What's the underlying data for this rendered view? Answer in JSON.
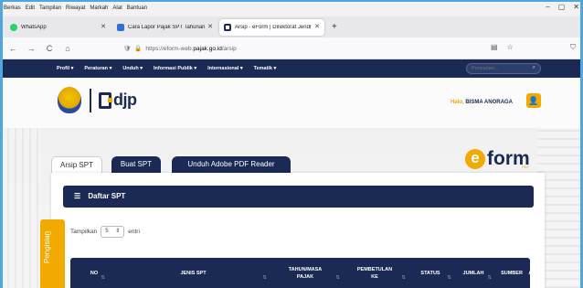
{
  "browser": {
    "menu": [
      "Berkas",
      "Edit",
      "Tampilan",
      "Riwayat",
      "Markah",
      "Alat",
      "Bantuan"
    ],
    "window_controls": {
      "minimize": "–",
      "maximize": "▢",
      "close": "✕"
    },
    "tabs": [
      {
        "title": "WhatsApp",
        "favicon_color": "#25d366",
        "active": false
      },
      {
        "title": "Cara Lapor Pajak SPT Tahunan",
        "favicon_color": "#2f6fd6",
        "active": false
      },
      {
        "title": "Arsip - eForm | Direktorat Jendr",
        "favicon_color": "#1a2a55",
        "active": true
      }
    ],
    "new_tab": "+",
    "nav": {
      "back": "←",
      "forward": "→",
      "reload": "C",
      "home": "⌂"
    },
    "url_prefix": "https://eform-web.",
    "url_host": "pajak.go.id",
    "url_path": "/arsip",
    "icons": [
      "reader-icon",
      "bookmark-star-icon",
      "shield-icon"
    ]
  },
  "site_nav": {
    "items": [
      "Profil ▾",
      "Peraturan ▾",
      "Unduh ▾",
      "Informasi Publik ▾",
      "Internasional ▾",
      "Tematik ▾"
    ],
    "search_placeholder": "Pencarian..."
  },
  "header": {
    "logo_text": "djp",
    "greeting": "Halo,",
    "user_name": "BISMA ANORAGA"
  },
  "eform_logo": {
    "e": "e",
    "form": "form",
    "tag": "PDF"
  },
  "main_tabs": [
    "Arsip SPT",
    "Buat SPT",
    "Unduh Adobe PDF Reader"
  ],
  "panel": {
    "title": "Daftar SPT",
    "show_label": "Tampilkan",
    "show_value": "5",
    "entries_label": "entri"
  },
  "table": {
    "headers": [
      "NO",
      "JENIS SPT",
      "TAHUN/MASA PAJAK",
      "PEMBETULAN KE",
      "STATUS",
      "JUMLAH",
      "SUMBER",
      "AKSI"
    ]
  },
  "side_tab": {
    "label": "Pengisian",
    "arrow": "›"
  },
  "colors": {
    "navy": "#1a2a55",
    "accent": "#f2a900",
    "frame": "#4ea8de"
  }
}
